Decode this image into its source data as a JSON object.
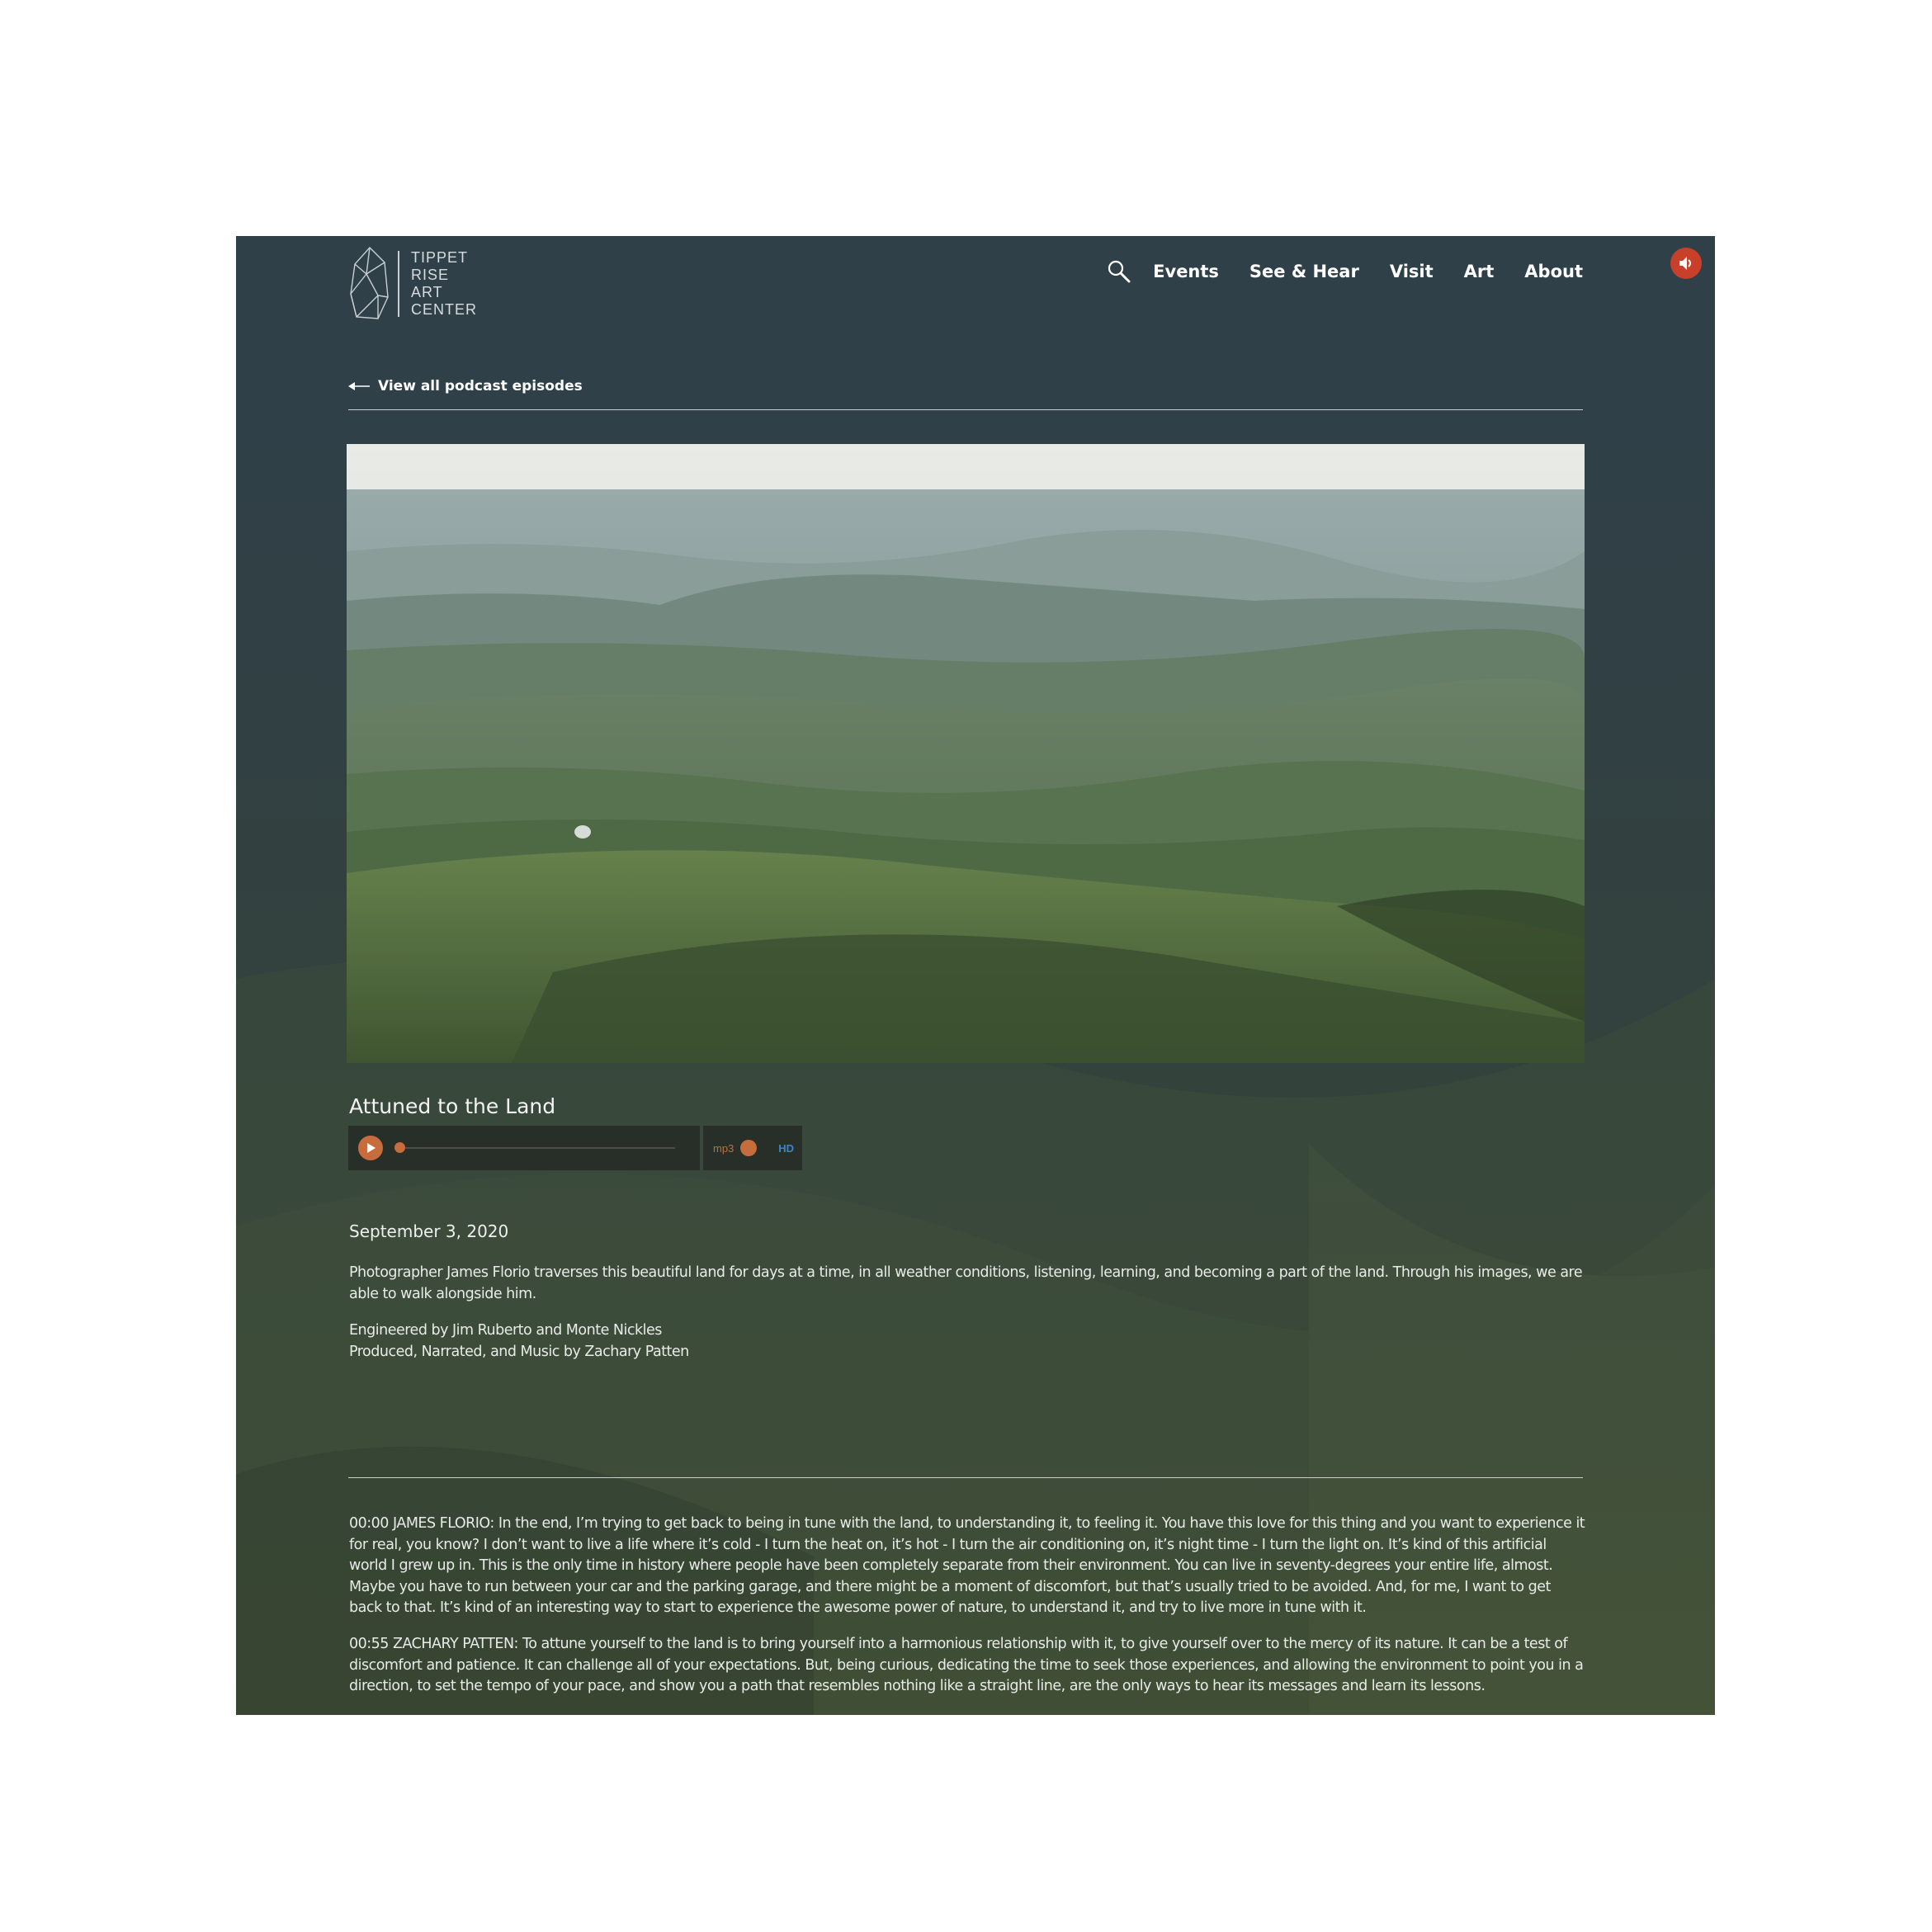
{
  "logo": {
    "lines": [
      "TIPPET",
      "RISE",
      "ART",
      "CENTER"
    ]
  },
  "nav": {
    "search_icon": "search-icon",
    "items": [
      "Events",
      "See & Hear",
      "Visit",
      "Art",
      "About"
    ]
  },
  "sound_toggle": {
    "icon": "speaker-icon",
    "color": "#c9402a"
  },
  "back_link": "View all podcast episodes",
  "episode": {
    "title": "Attuned to the Land",
    "date": "September 3, 2020",
    "description": "Photographer James Florio traverses this beautiful land for days at a time, in all weather conditions, listening, learning, and becoming a part of the land. Through his images, we are able to walk alongside him.",
    "credits": [
      "Engineered by Jim Ruberto and Monte Nickles",
      "Produced, Narrated, and Music by Zachary Patten"
    ]
  },
  "player": {
    "play_icon": "play-icon",
    "progress": 0,
    "format_label": "mp3",
    "quality_label": "HD",
    "accent": "#c76c3c"
  },
  "transcript": [
    "00:00 JAMES FLORIO: In the end, I’m trying to get back to being in tune with the land, to understanding it, to feeling it. You have this love for this thing and you want to experience it for real, you know? I don’t want to live a life where it’s cold - I turn the heat on, it’s hot - I turn the air conditioning on, it’s night time - I turn the light on. It’s kind of this artificial world I grew up in. This is the only time in history where people have been completely separate from their environment. You can live in seventy-degrees your entire life, almost. Maybe you have to run between your car and the parking garage, and there might be a moment of discomfort, but that’s usually tried to be avoided. And, for me, I want to get back to that. It’s kind of an interesting way to start to experience the awesome power of nature, to understand it, and try to live more in tune with it.",
    "00:55 ZACHARY PATTEN: To attune yourself to the land is to bring yourself into a harmonious relationship with it, to give yourself over to the mercy of its nature. It can be a test of discomfort and patience. It can challenge all of your expectations. But, being curious, dedicating the time to seek those experiences, and allowing the environment to point you in a direction, to set the tempo of your pace, and show you a path that resembles nothing like a straight line, are the only ways to hear its messages and learn its lessons."
  ]
}
